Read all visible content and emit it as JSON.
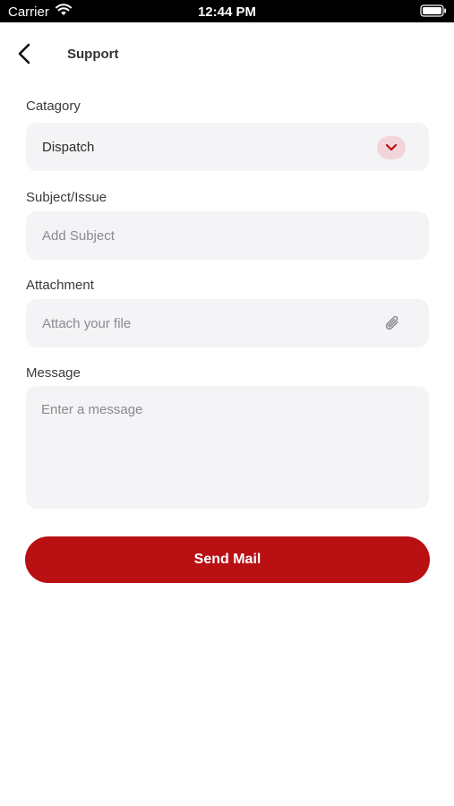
{
  "status_bar": {
    "carrier": "Carrier",
    "time": "12:44 PM"
  },
  "header": {
    "title": "Support",
    "back_icon": "chevron-left-icon"
  },
  "form": {
    "category": {
      "label": "Catagory",
      "value": "Dispatch",
      "icon": "chevron-down-icon"
    },
    "subject": {
      "label": "Subject/Issue",
      "placeholder": "Add Subject"
    },
    "attachment": {
      "label": "Attachment",
      "placeholder": "Attach your file",
      "icon": "paperclip-icon"
    },
    "message": {
      "label": "Message",
      "placeholder": "Enter a message"
    }
  },
  "actions": {
    "send_label": "Send Mail"
  },
  "colors": {
    "accent": "#b91014",
    "field_bg": "#f4f4f6",
    "chevron_bg": "#f2d5d8"
  }
}
